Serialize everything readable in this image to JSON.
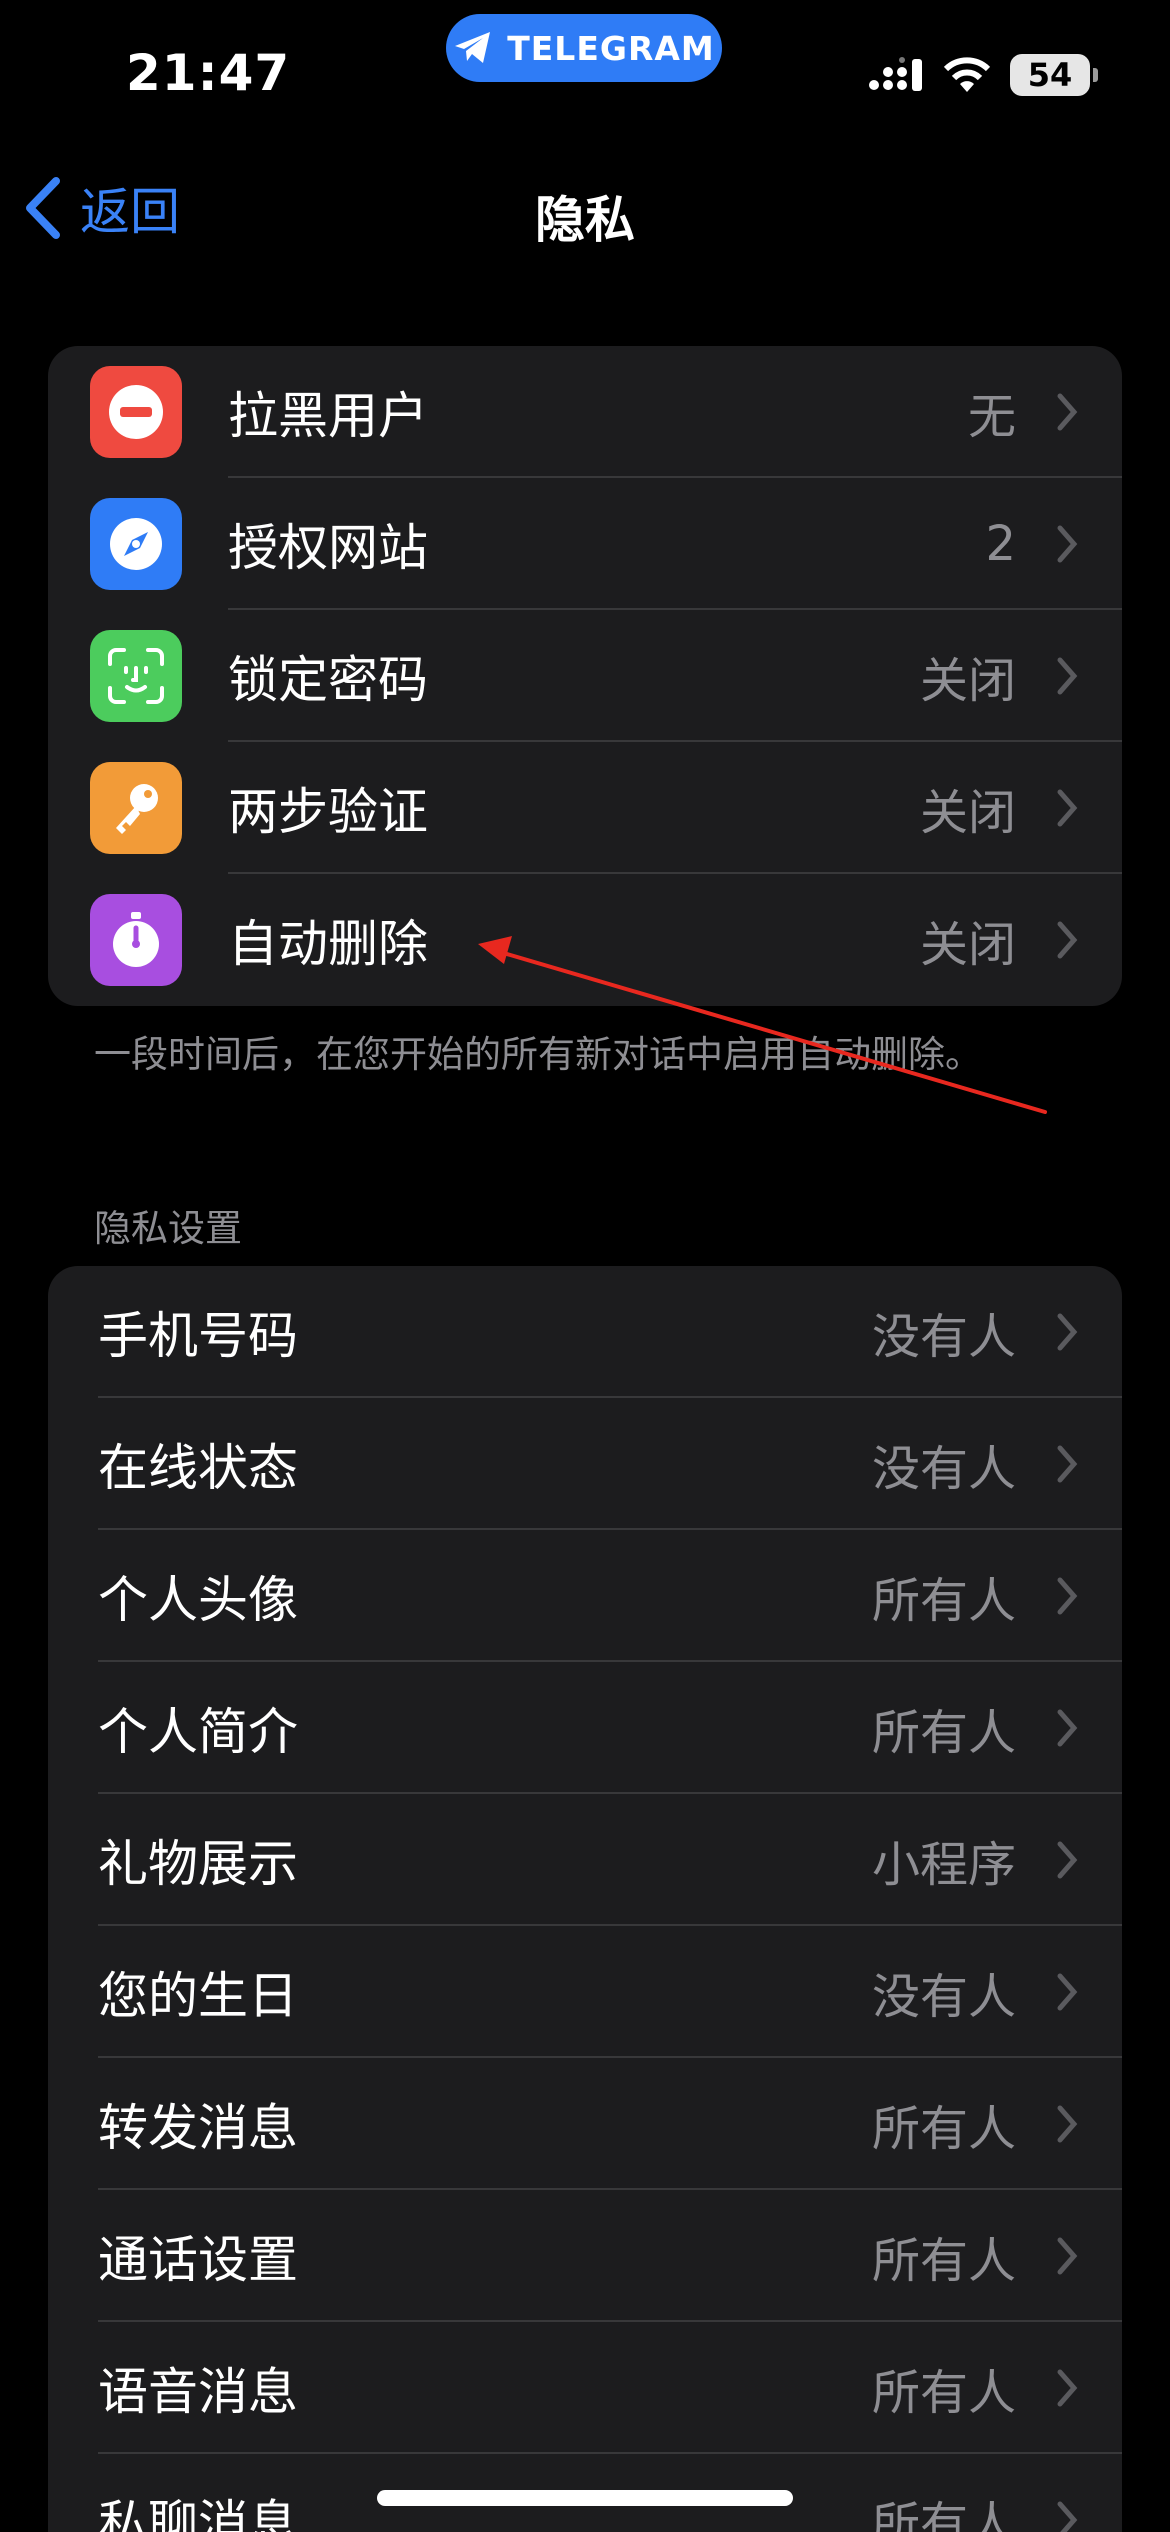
{
  "status_bar": {
    "time": "21:47",
    "app_pill": "TELEGRAM",
    "battery": "54"
  },
  "nav": {
    "back_label": "返回",
    "title": "隐私"
  },
  "top_group": {
    "items": [
      {
        "label": "拉黑用户",
        "value": "无",
        "icon": "no-entry-icon",
        "color": "#ef4a40"
      },
      {
        "label": "授权网站",
        "value": "2",
        "icon": "compass-icon",
        "color": "#2f7cf6"
      },
      {
        "label": "锁定密码",
        "value": "关闭",
        "icon": "face-id-icon",
        "color": "#4ccc5d"
      },
      {
        "label": "两步验证",
        "value": "关闭",
        "icon": "key-icon",
        "color": "#f29b38"
      },
      {
        "label": "自动删除",
        "value": "关闭",
        "icon": "timer-icon",
        "color": "#a84ee0"
      }
    ],
    "footer": "一段时间后，在您开始的所有新对话中启用自动删除。"
  },
  "privacy_settings": {
    "header": "隐私设置",
    "items": [
      {
        "label": "手机号码",
        "value": "没有人"
      },
      {
        "label": "在线状态",
        "value": "没有人"
      },
      {
        "label": "个人头像",
        "value": "所有人"
      },
      {
        "label": "个人简介",
        "value": "所有人"
      },
      {
        "label": "礼物展示",
        "value": "小程序"
      },
      {
        "label": "您的生日",
        "value": "没有人"
      },
      {
        "label": "转发消息",
        "value": "所有人"
      },
      {
        "label": "通话设置",
        "value": "所有人"
      },
      {
        "label": "语音消息",
        "value": "所有人"
      },
      {
        "label": "私聊消息",
        "value": "所有人"
      }
    ]
  },
  "annotation": {
    "color": "#e8281f"
  }
}
